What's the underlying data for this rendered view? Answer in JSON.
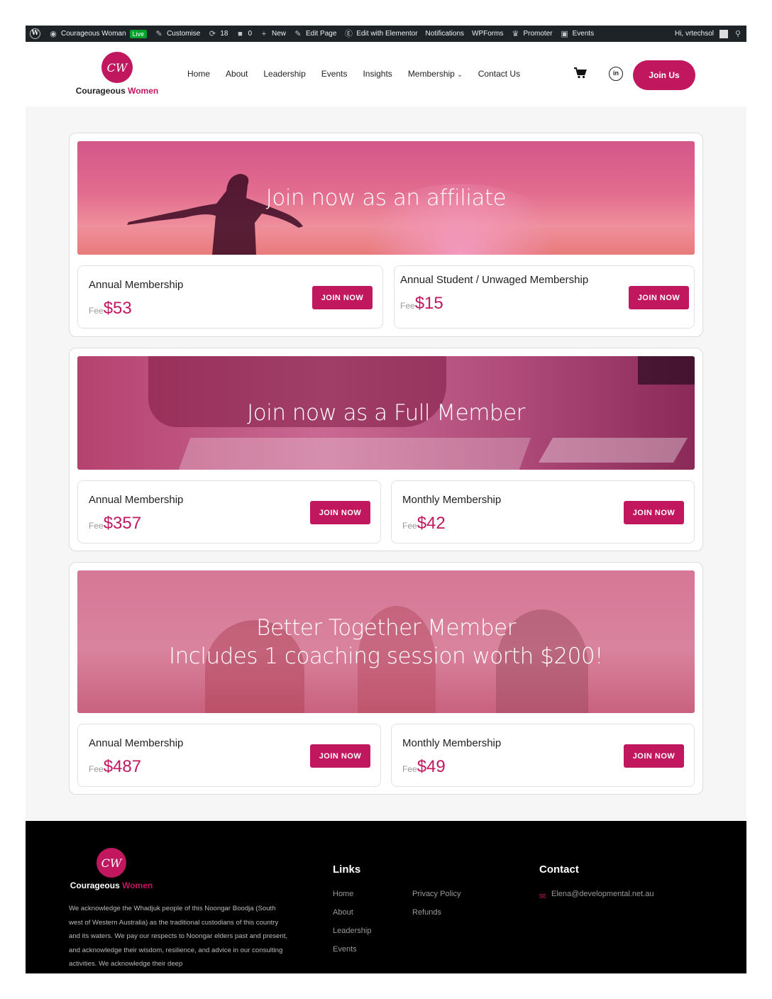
{
  "adminbar": {
    "site": "Courageous Woman",
    "live": "Live",
    "customise": "Customise",
    "updates": "18",
    "comments": "0",
    "new": "New",
    "edit_page": "Edit Page",
    "elementor": "Edit with Elementor",
    "notifications": "Notifications",
    "wpforms": "WPForms",
    "promoter": "Promoter",
    "events": "Events",
    "greeting": "Hi, vrtechsol"
  },
  "header": {
    "logo_name": "Courageous",
    "logo_accent": "Women",
    "nav": [
      "Home",
      "About",
      "Leadership",
      "Events",
      "Insights",
      "Membership",
      "Contact Us"
    ],
    "join": "Join Us"
  },
  "cards": [
    {
      "title": "Join now as an affiliate",
      "plans": [
        {
          "name": "Annual Membership",
          "fee_label": "Fee",
          "price": "$53",
          "button": "JOIN NOW"
        },
        {
          "name": "Annual Student / Unwaged Membership",
          "fee_label": "Fee",
          "price": "$15",
          "button": "JOIN NOW"
        }
      ]
    },
    {
      "title": "Join now as a Full Member",
      "plans": [
        {
          "name": "Annual Membership",
          "fee_label": "Fee",
          "price": "$357",
          "button": "JOIN NOW"
        },
        {
          "name": "Monthly Membership",
          "fee_label": "Fee",
          "price": "$42",
          "button": "JOIN NOW"
        }
      ]
    },
    {
      "title_line1": "Better Together Member",
      "title_line2": "Includes 1 coaching session worth $200!",
      "plans": [
        {
          "name": "Annual Membership",
          "fee_label": "Fee",
          "price": "$487",
          "button": "JOIN NOW"
        },
        {
          "name": "Monthly Membership",
          "fee_label": "Fee",
          "price": "$49",
          "button": "JOIN NOW"
        }
      ]
    }
  ],
  "footer": {
    "logo_name": "Courageous",
    "logo_accent": "Women",
    "acknowledgement": "We acknowledge the Whadjuk people of this Noongar Boodja (South west of Western Australia) as the traditional custodians of this country and its waters. We pay our respects to Noongar elders past and present, and acknowledge their wisdom, resilience, and advice in our consulting activities. We acknowledge their deep",
    "links_heading": "Links",
    "links_col1": [
      "Home",
      "About",
      "Leadership",
      "Events"
    ],
    "links_col2": [
      "Privacy Policy",
      "Refunds"
    ],
    "contact_heading": "Contact",
    "email": "Elena@developmental.net.au"
  },
  "colors": {
    "accent": "#c1175f",
    "adminbar": "#1d2327",
    "footer": "#000000"
  }
}
